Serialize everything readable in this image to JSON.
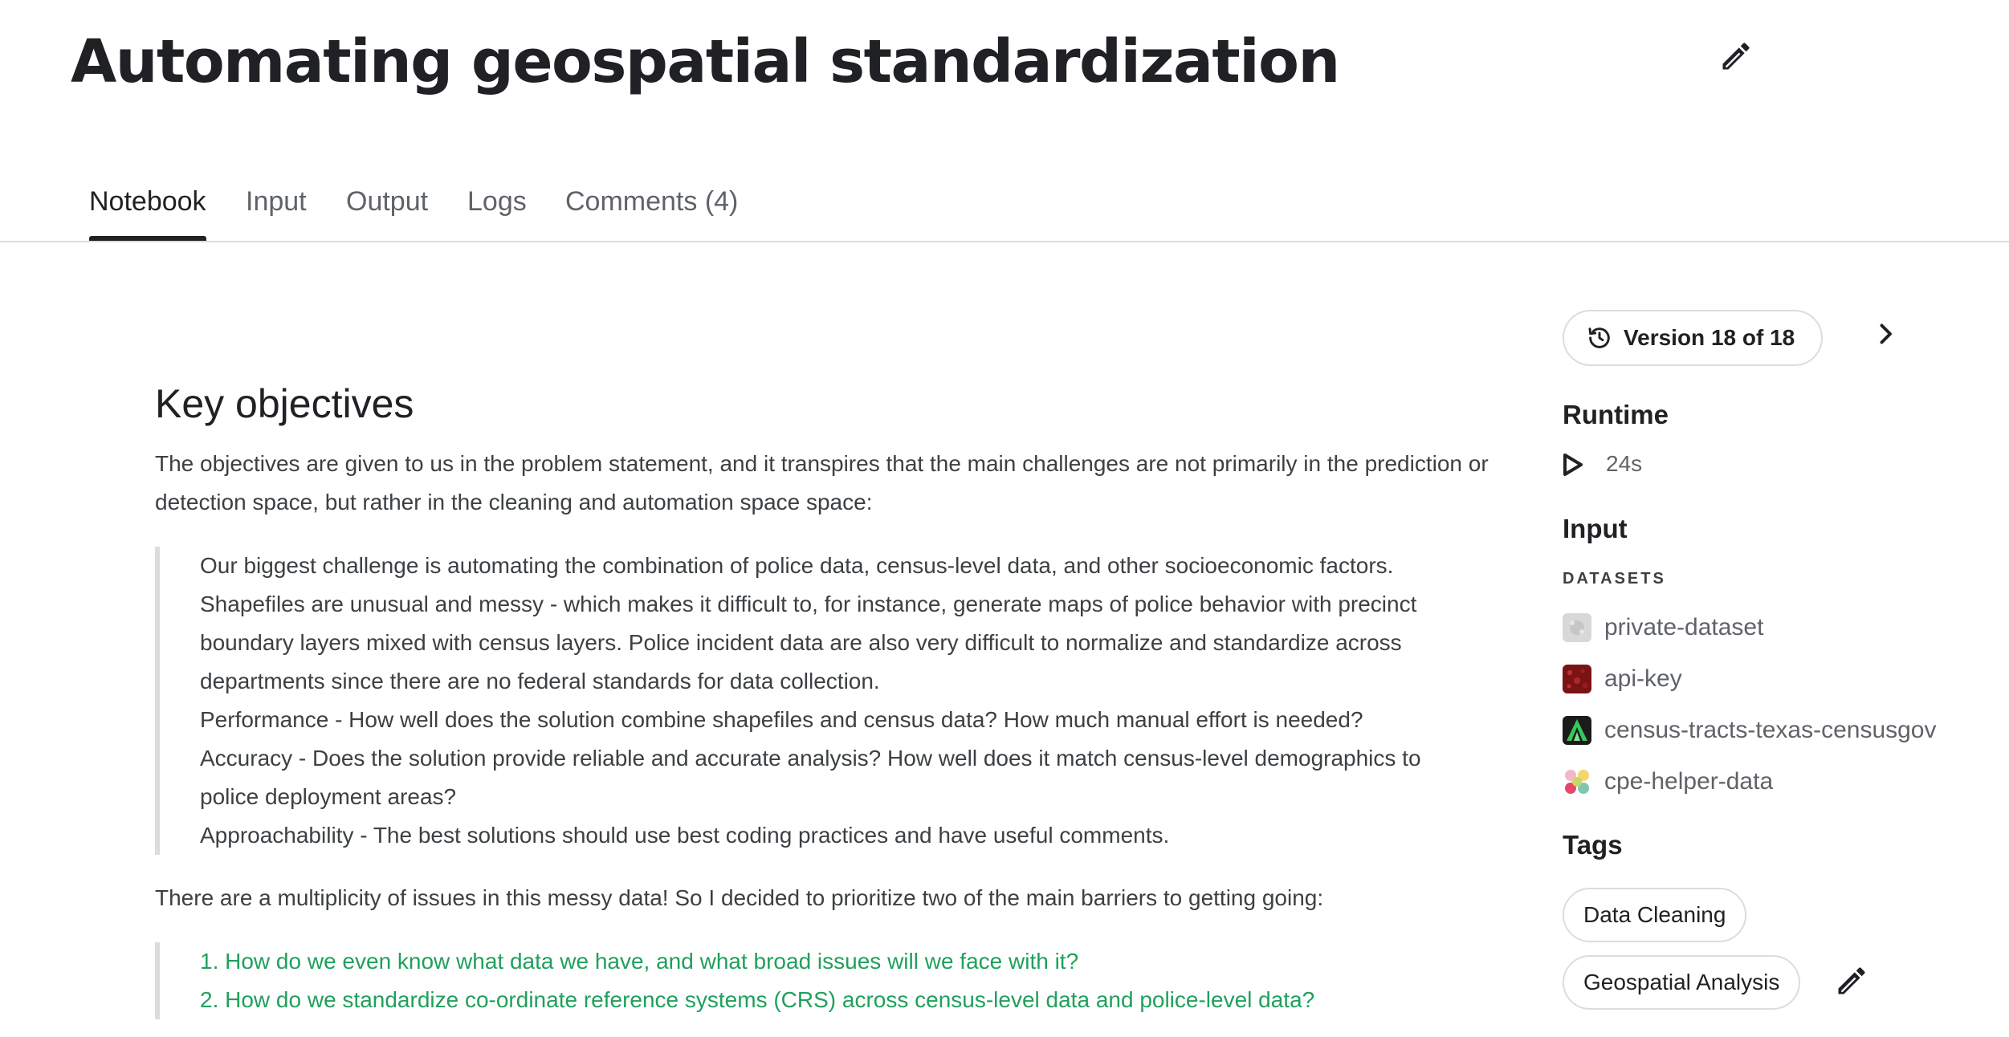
{
  "header": {
    "title": "Automating geospatial standardization"
  },
  "tabs": [
    {
      "label": "Notebook",
      "active": true
    },
    {
      "label": "Input",
      "active": false
    },
    {
      "label": "Output",
      "active": false
    },
    {
      "label": "Logs",
      "active": false
    },
    {
      "label": "Comments (4)",
      "active": false
    }
  ],
  "notebook": {
    "heading": "Key objectives",
    "intro": "The objectives are given to us in the problem statement, and it transpires that the main challenges are not primarily in the prediction or detection space, but rather in the cleaning and automation space space:",
    "quote_lines": [
      "Our biggest challenge is automating the combination of police data, census-level data, and other socioeconomic factors. Shapefiles are unusual and messy - which makes it difficult to, for instance, generate maps of police behavior with precinct boundary layers mixed with census layers. Police incident data are also very difficult to normalize and standardize across departments since there are no federal standards for data collection.",
      "Performance - How well does the solution combine shapefiles and census data? How much manual effort is needed?",
      "Accuracy - Does the solution provide reliable and accurate analysis? How well does it match census-level demographics to police deployment areas?",
      "Approachability - The best solutions should use best coding practices and have useful comments."
    ],
    "issues_intro": "There are a multiplicity of issues in this messy data! So I decided to prioritize two of the main barriers to getting going:",
    "questions": [
      "1. How do we even know what data we have, and what broad issues will we face with it?",
      "2. How do we standardize co-ordinate reference systems (CRS) across census-level data and police-level data?"
    ],
    "link_color": "#20a05c"
  },
  "sidebar": {
    "version_label": "Version 18 of 18",
    "runtime_heading": "Runtime",
    "runtime_value": "24s",
    "input_heading": "Input",
    "datasets_caption": "DATASETS",
    "datasets": [
      {
        "name": "private-dataset",
        "icon": "private-dataset-icon"
      },
      {
        "name": "api-key",
        "icon": "api-key-icon"
      },
      {
        "name": "census-tracts-texas-censusgov",
        "icon": "census-tracts-icon"
      },
      {
        "name": "cpe-helper-data",
        "icon": "cpe-helper-icon"
      }
    ],
    "tags_heading": "Tags",
    "tags": [
      "Data Cleaning",
      "Geospatial Analysis"
    ]
  }
}
